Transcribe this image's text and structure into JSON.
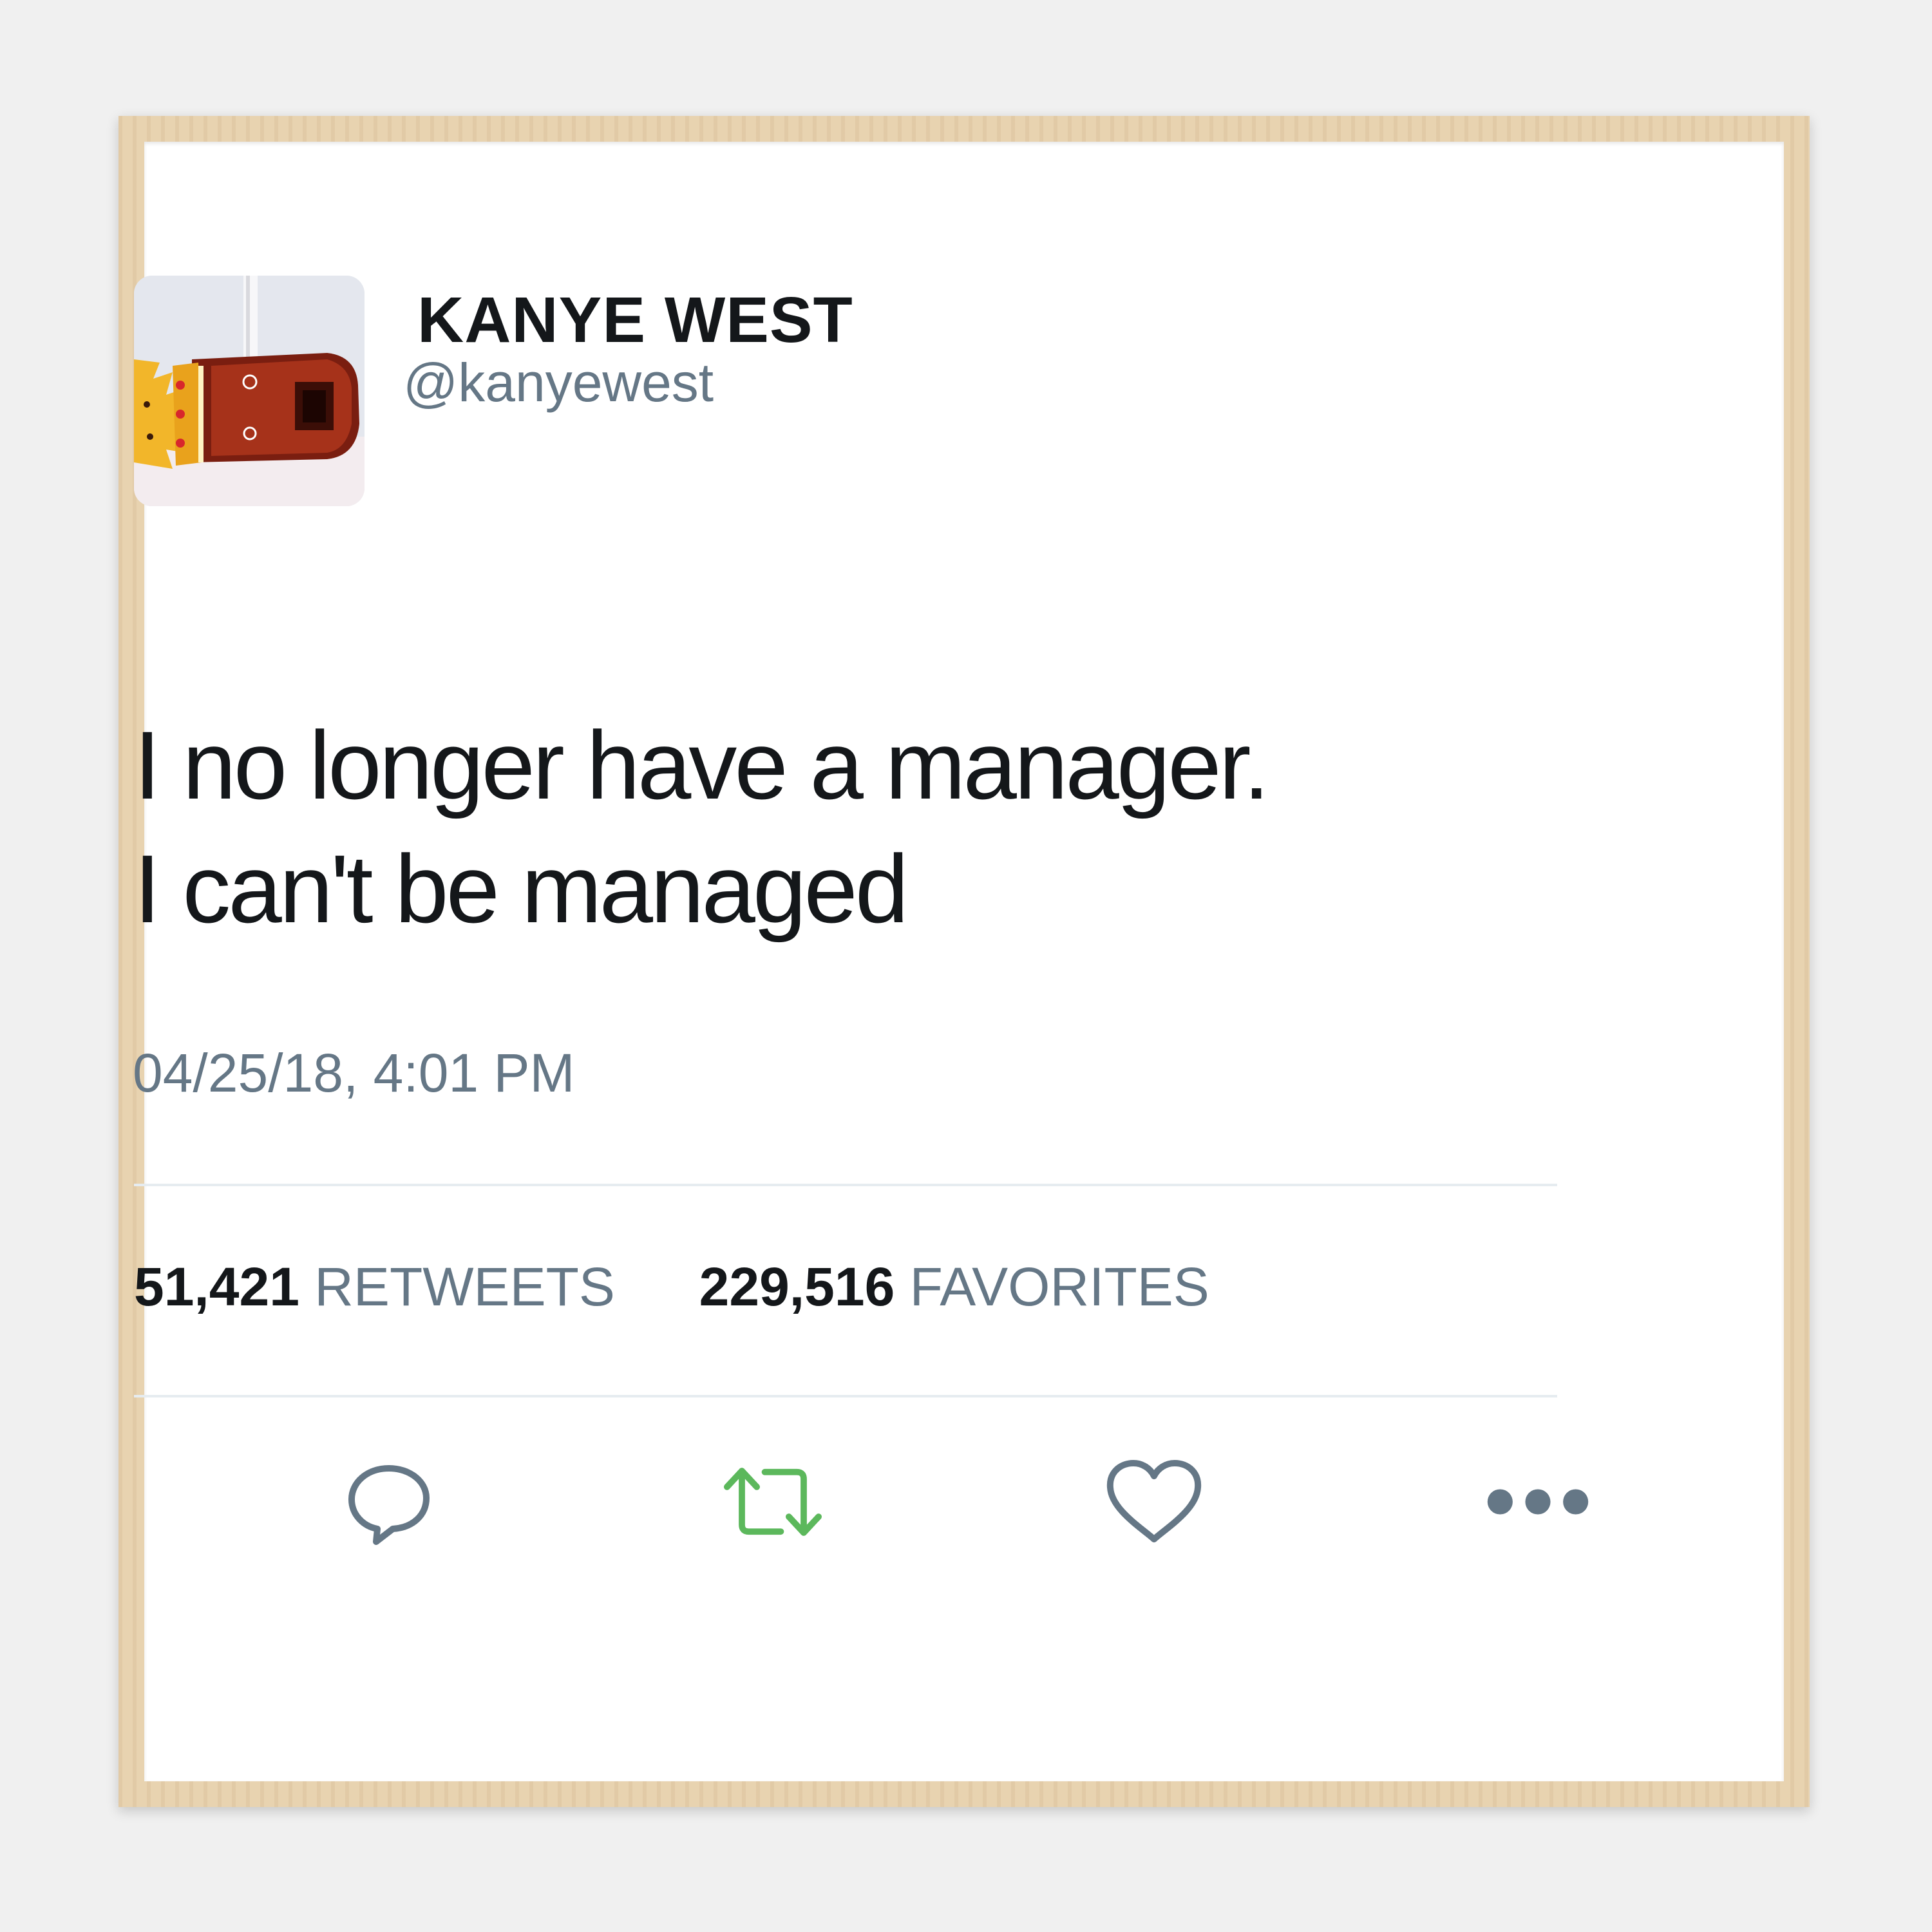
{
  "profile": {
    "name": "KANYE WEST",
    "handle": "@kanyewest"
  },
  "tweet": {
    "line1": "I no longer have a manager.",
    "line2": "I can't be managed",
    "timestamp": "04/25/18, 4:01 PM"
  },
  "stats": {
    "retweets_count": "51,421",
    "retweets_label": "RETWEETS",
    "favorites_count": "229,516",
    "favorites_label": "FAVORITES"
  },
  "actions": [
    {
      "icon": "reply-icon",
      "color": "#657786"
    },
    {
      "icon": "retweet-icon",
      "color": "#5cb85c"
    },
    {
      "icon": "heart-icon",
      "color": "#657786"
    },
    {
      "icon": "more-icon",
      "color": "#657786"
    }
  ],
  "colors": {
    "text_primary": "#14171a",
    "text_secondary": "#657786",
    "retweet_active": "#5cb85c",
    "frame_wood": "#e8d3b0"
  }
}
